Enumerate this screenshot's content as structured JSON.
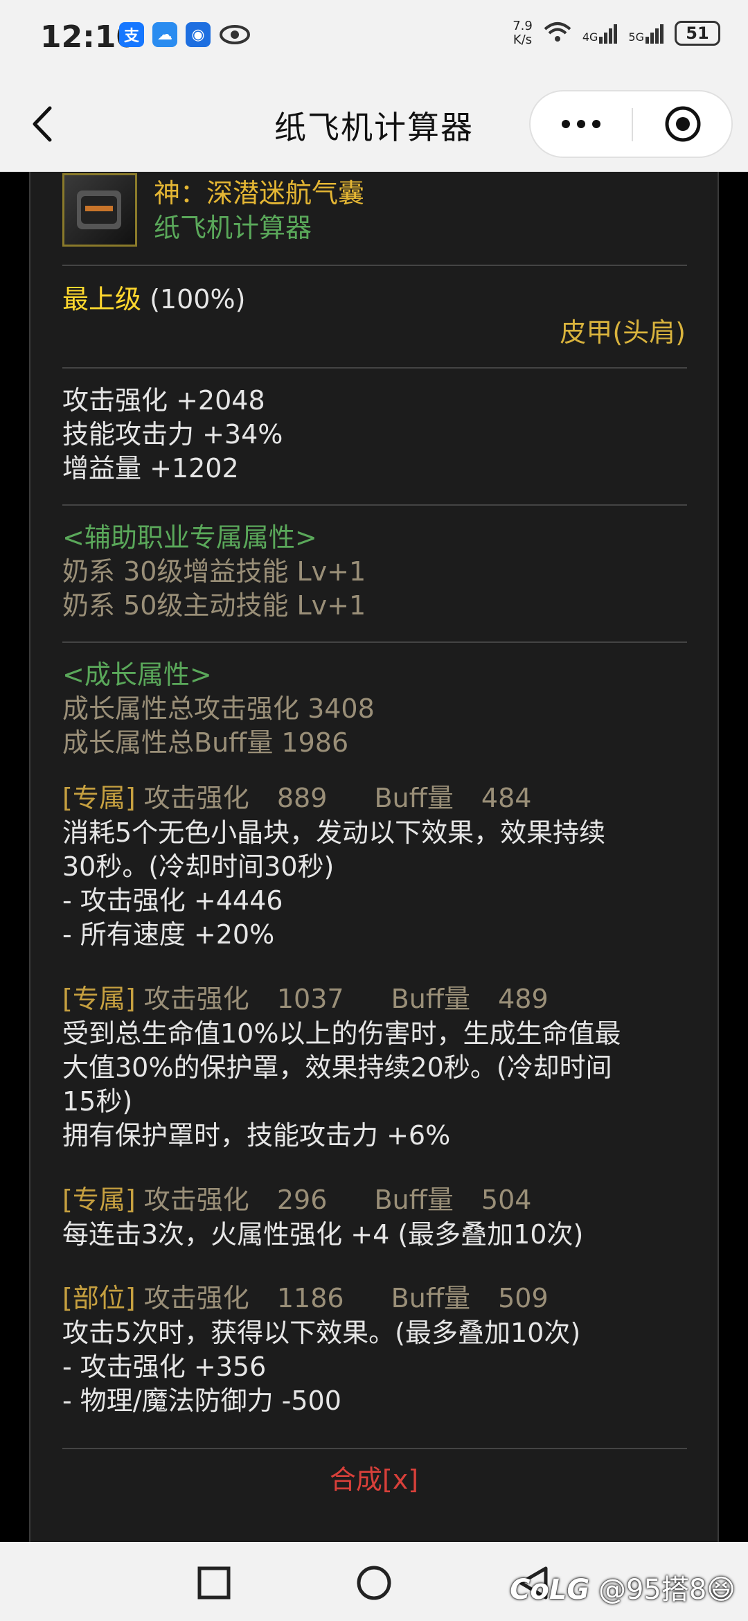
{
  "status": {
    "time": "12:10",
    "net_speed_top": "7.9",
    "net_speed_bottom": "K/s",
    "signal1": "4G",
    "signal2": "5G",
    "battery": "51"
  },
  "titlebar": {
    "title": "纸飞机计算器"
  },
  "item": {
    "name": "神：深潜迷航气囊",
    "subtitle": "纸飞机计算器"
  },
  "grade": {
    "label": "最上级",
    "percent": "(100%)",
    "slot": "皮甲(头肩)"
  },
  "base_stats": [
    "攻击强化 +2048",
    "技能攻击力 +34%",
    "增益量 +1202"
  ],
  "support": {
    "header": "<辅助职业专属属性>",
    "lines": [
      "奶系 30级增益技能 Lv+1",
      "奶系 50级主动技能 Lv+1"
    ]
  },
  "growth": {
    "header": "<成长属性>",
    "total_attack": "成长属性总攻击强化 3408",
    "total_buff": "成长属性总Buff量 1986"
  },
  "options": [
    {
      "tag": "[专属]",
      "atk_label": "攻击强化",
      "atk": "889",
      "buff_label": "Buff量",
      "buff": "484",
      "lines": [
        "消耗5个无色小晶块，发动以下效果，效果持续",
        "30秒。(冷却时间30秒)",
        "- 攻击强化 +4446",
        "- 所有速度 +20%"
      ]
    },
    {
      "tag": "[专属]",
      "atk_label": "攻击强化",
      "atk": "1037",
      "buff_label": "Buff量",
      "buff": "489",
      "lines": [
        "受到总生命值10%以上的伤害时，生成生命值最",
        "大值30%的保护罩，效果持续20秒。(冷却时间",
        "15秒)",
        "拥有保护罩时，技能攻击力 +6%"
      ]
    },
    {
      "tag": "[专属]",
      "atk_label": "攻击强化",
      "atk": "296",
      "buff_label": "Buff量",
      "buff": "504",
      "lines": [
        "每连击3次，火属性强化 +4 (最多叠加10次)"
      ]
    },
    {
      "tag": "[部位]",
      "atk_label": "攻击强化",
      "atk": "1186",
      "buff_label": "Buff量",
      "buff": "509",
      "lines": [
        "攻击5次时，获得以下效果。(最多叠加10次)",
        "- 攻击强化 +356",
        "- 物理/魔法防御力 -500"
      ]
    }
  ],
  "footer": {
    "combine": "合成[x]"
  },
  "watermark": "@95搭8"
}
